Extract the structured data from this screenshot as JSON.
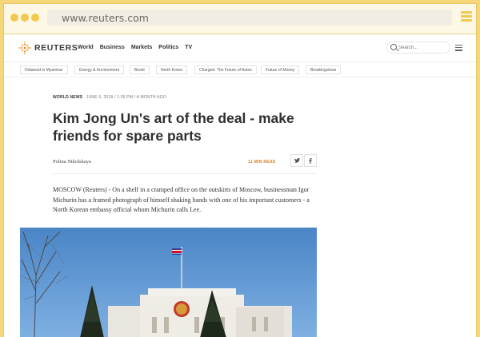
{
  "browser": {
    "url": "www.reuters.com",
    "accent": "#f2c94c"
  },
  "header": {
    "brand": "REUTERS",
    "nav": [
      "World",
      "Business",
      "Markets",
      "Politics",
      "TV"
    ],
    "search_placeholder": "Search..."
  },
  "topics": [
    "Detained in Myanmar",
    "Energy & Environment",
    "Brexit",
    "North Korea",
    "Charged: The Future of Autos",
    "Future of Money",
    "Breakingviews"
  ],
  "article": {
    "category": "WORLD NEWS",
    "dateline": "JUNE 6, 2018 / 1:05 PM / A MONTH AGO",
    "title": "Kim Jong Un's art of the deal - make friends for spare parts",
    "author": "Polina Nikolskaya",
    "read_time": "11 MIN READ",
    "share_icons": [
      "twitter-icon",
      "facebook-icon"
    ],
    "lede": "MOSCOW (Reuters) - On a shelf in a cramped office on the outskirts of Moscow, businessman Igor Michurin has a framed photograph of himself shaking hands with one of his important customers - a North Korean embassy official whom Michurin calls Lee."
  }
}
